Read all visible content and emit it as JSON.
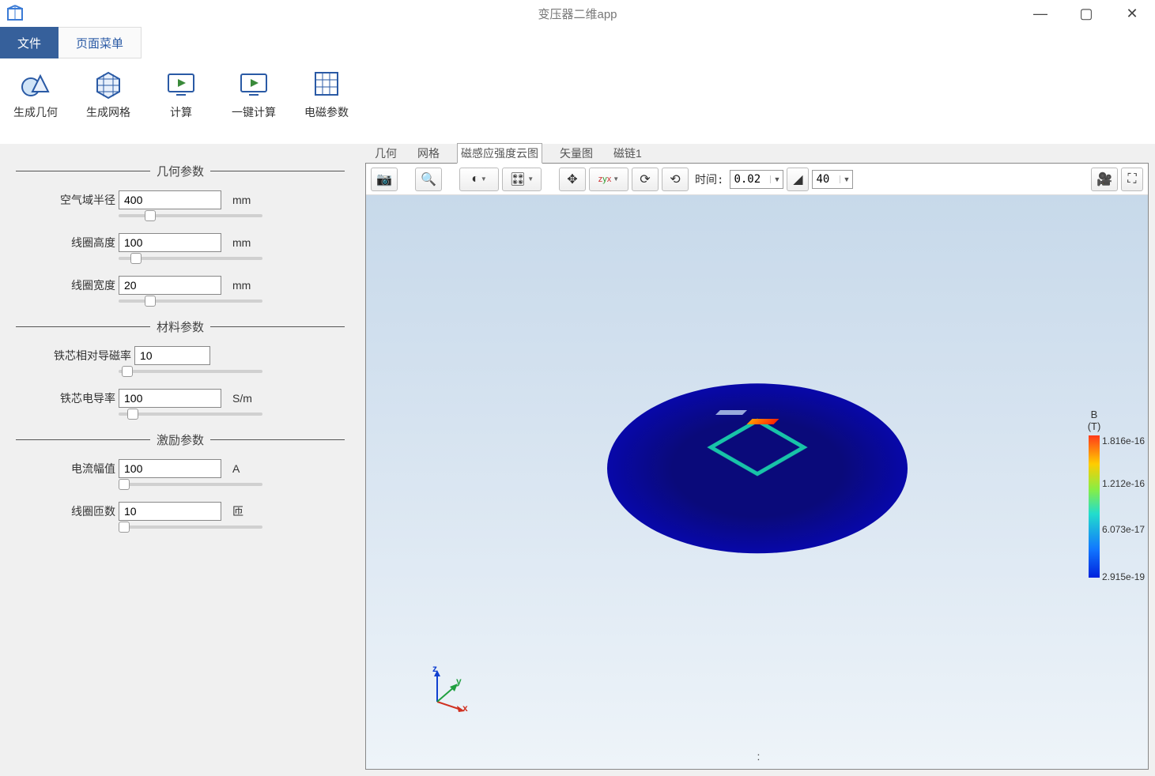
{
  "app": {
    "title": "变压器二维app"
  },
  "menu": {
    "tab_file": "文件",
    "tab_page": "页面菜单"
  },
  "ribbon": {
    "gen_geometry": "生成几何",
    "gen_mesh": "生成网格",
    "compute": "计算",
    "one_click": "一键计算",
    "em_params": "电磁参数"
  },
  "sections": {
    "geometry": "几何参数",
    "material": "材料参数",
    "excitation": "激励参数"
  },
  "params": {
    "air_radius": {
      "label": "空气域半径",
      "value": "400",
      "unit": "mm",
      "thumb_pct": 18
    },
    "coil_height": {
      "label": "线圈高度",
      "value": "100",
      "unit": "mm",
      "thumb_pct": 8
    },
    "coil_width": {
      "label": "线圈宽度",
      "value": "20",
      "unit": "mm",
      "thumb_pct": 18
    },
    "iron_mu": {
      "label": "铁芯相对导磁率",
      "value": "10",
      "unit": "",
      "thumb_pct": 2
    },
    "iron_sigma": {
      "label": "铁芯电导率",
      "value": "100",
      "unit": "S/m",
      "thumb_pct": 6
    },
    "current_amp": {
      "label": "电流幅值",
      "value": "100",
      "unit": "A",
      "thumb_pct": 0
    },
    "coil_turns": {
      "label": "线圈匝数",
      "value": "10",
      "unit": "匝",
      "thumb_pct": 0
    }
  },
  "view_tabs": {
    "geometry": "几何",
    "mesh": "网格",
    "b_cloud": "磁感应强度云图",
    "vector": "矢量图",
    "flux1": "磁链1"
  },
  "toolbar": {
    "time_label": "时间:",
    "time_value": "0.02",
    "angle_value": "40"
  },
  "legend": {
    "title1": "B",
    "title2": "(T)",
    "t0": "1.816e-16",
    "t1": "1.212e-16",
    "t2": "6.073e-17",
    "t3": "2.915e-19"
  },
  "triad": {
    "x": "x",
    "y": "y",
    "z": "z"
  }
}
